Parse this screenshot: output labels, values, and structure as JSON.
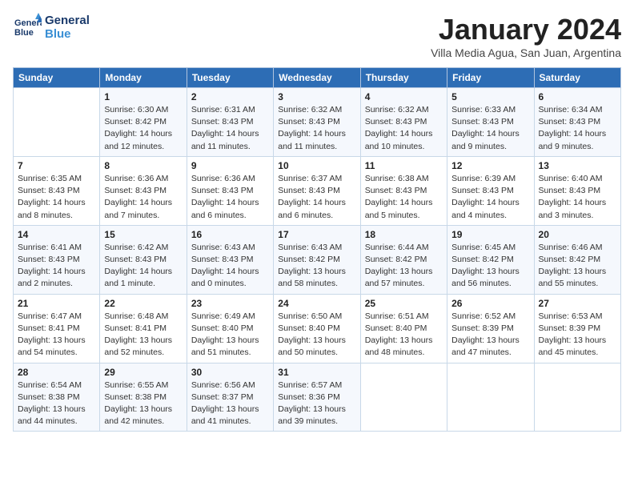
{
  "logo": {
    "line1": "General",
    "line2": "Blue"
  },
  "title": "January 2024",
  "subtitle": "Villa Media Agua, San Juan, Argentina",
  "headers": [
    "Sunday",
    "Monday",
    "Tuesday",
    "Wednesday",
    "Thursday",
    "Friday",
    "Saturday"
  ],
  "weeks": [
    [
      {
        "day": "",
        "info": ""
      },
      {
        "day": "1",
        "info": "Sunrise: 6:30 AM\nSunset: 8:42 PM\nDaylight: 14 hours\nand 12 minutes."
      },
      {
        "day": "2",
        "info": "Sunrise: 6:31 AM\nSunset: 8:43 PM\nDaylight: 14 hours\nand 11 minutes."
      },
      {
        "day": "3",
        "info": "Sunrise: 6:32 AM\nSunset: 8:43 PM\nDaylight: 14 hours\nand 11 minutes."
      },
      {
        "day": "4",
        "info": "Sunrise: 6:32 AM\nSunset: 8:43 PM\nDaylight: 14 hours\nand 10 minutes."
      },
      {
        "day": "5",
        "info": "Sunrise: 6:33 AM\nSunset: 8:43 PM\nDaylight: 14 hours\nand 9 minutes."
      },
      {
        "day": "6",
        "info": "Sunrise: 6:34 AM\nSunset: 8:43 PM\nDaylight: 14 hours\nand 9 minutes."
      }
    ],
    [
      {
        "day": "7",
        "info": "Sunrise: 6:35 AM\nSunset: 8:43 PM\nDaylight: 14 hours\nand 8 minutes."
      },
      {
        "day": "8",
        "info": "Sunrise: 6:36 AM\nSunset: 8:43 PM\nDaylight: 14 hours\nand 7 minutes."
      },
      {
        "day": "9",
        "info": "Sunrise: 6:36 AM\nSunset: 8:43 PM\nDaylight: 14 hours\nand 6 minutes."
      },
      {
        "day": "10",
        "info": "Sunrise: 6:37 AM\nSunset: 8:43 PM\nDaylight: 14 hours\nand 6 minutes."
      },
      {
        "day": "11",
        "info": "Sunrise: 6:38 AM\nSunset: 8:43 PM\nDaylight: 14 hours\nand 5 minutes."
      },
      {
        "day": "12",
        "info": "Sunrise: 6:39 AM\nSunset: 8:43 PM\nDaylight: 14 hours\nand 4 minutes."
      },
      {
        "day": "13",
        "info": "Sunrise: 6:40 AM\nSunset: 8:43 PM\nDaylight: 14 hours\nand 3 minutes."
      }
    ],
    [
      {
        "day": "14",
        "info": "Sunrise: 6:41 AM\nSunset: 8:43 PM\nDaylight: 14 hours\nand 2 minutes."
      },
      {
        "day": "15",
        "info": "Sunrise: 6:42 AM\nSunset: 8:43 PM\nDaylight: 14 hours\nand 1 minute."
      },
      {
        "day": "16",
        "info": "Sunrise: 6:43 AM\nSunset: 8:43 PM\nDaylight: 14 hours\nand 0 minutes."
      },
      {
        "day": "17",
        "info": "Sunrise: 6:43 AM\nSunset: 8:42 PM\nDaylight: 13 hours\nand 58 minutes."
      },
      {
        "day": "18",
        "info": "Sunrise: 6:44 AM\nSunset: 8:42 PM\nDaylight: 13 hours\nand 57 minutes."
      },
      {
        "day": "19",
        "info": "Sunrise: 6:45 AM\nSunset: 8:42 PM\nDaylight: 13 hours\nand 56 minutes."
      },
      {
        "day": "20",
        "info": "Sunrise: 6:46 AM\nSunset: 8:42 PM\nDaylight: 13 hours\nand 55 minutes."
      }
    ],
    [
      {
        "day": "21",
        "info": "Sunrise: 6:47 AM\nSunset: 8:41 PM\nDaylight: 13 hours\nand 54 minutes."
      },
      {
        "day": "22",
        "info": "Sunrise: 6:48 AM\nSunset: 8:41 PM\nDaylight: 13 hours\nand 52 minutes."
      },
      {
        "day": "23",
        "info": "Sunrise: 6:49 AM\nSunset: 8:40 PM\nDaylight: 13 hours\nand 51 minutes."
      },
      {
        "day": "24",
        "info": "Sunrise: 6:50 AM\nSunset: 8:40 PM\nDaylight: 13 hours\nand 50 minutes."
      },
      {
        "day": "25",
        "info": "Sunrise: 6:51 AM\nSunset: 8:40 PM\nDaylight: 13 hours\nand 48 minutes."
      },
      {
        "day": "26",
        "info": "Sunrise: 6:52 AM\nSunset: 8:39 PM\nDaylight: 13 hours\nand 47 minutes."
      },
      {
        "day": "27",
        "info": "Sunrise: 6:53 AM\nSunset: 8:39 PM\nDaylight: 13 hours\nand 45 minutes."
      }
    ],
    [
      {
        "day": "28",
        "info": "Sunrise: 6:54 AM\nSunset: 8:38 PM\nDaylight: 13 hours\nand 44 minutes."
      },
      {
        "day": "29",
        "info": "Sunrise: 6:55 AM\nSunset: 8:38 PM\nDaylight: 13 hours\nand 42 minutes."
      },
      {
        "day": "30",
        "info": "Sunrise: 6:56 AM\nSunset: 8:37 PM\nDaylight: 13 hours\nand 41 minutes."
      },
      {
        "day": "31",
        "info": "Sunrise: 6:57 AM\nSunset: 8:36 PM\nDaylight: 13 hours\nand 39 minutes."
      },
      {
        "day": "",
        "info": ""
      },
      {
        "day": "",
        "info": ""
      },
      {
        "day": "",
        "info": ""
      }
    ]
  ]
}
